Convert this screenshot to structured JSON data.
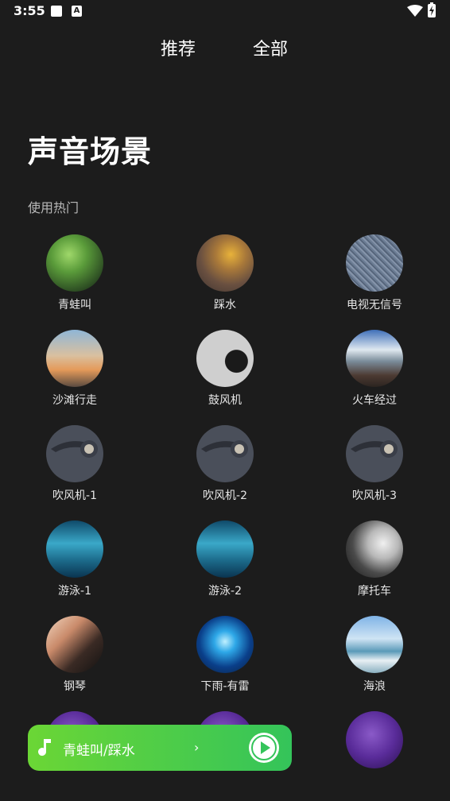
{
  "status_bar": {
    "time": "3:55",
    "icons": [
      "notification-square-icon",
      "accessibility-a-icon",
      "wifi-icon",
      "battery-charging-icon"
    ]
  },
  "tabs": [
    {
      "label": "推荐"
    },
    {
      "label": "全部"
    }
  ],
  "page": {
    "title": "声音场景",
    "section_label": "使用热门"
  },
  "scenes": [
    {
      "label": "青蛙叫",
      "image": "frog"
    },
    {
      "label": "踩水",
      "image": "splash"
    },
    {
      "label": "电视无信号",
      "image": "tv-static"
    },
    {
      "label": "沙滩行走",
      "image": "beach"
    },
    {
      "label": "鼓风机",
      "image": "blower"
    },
    {
      "label": "火车经过",
      "image": "train"
    },
    {
      "label": "吹风机-1",
      "image": "hair-dryer"
    },
    {
      "label": "吹风机-2",
      "image": "hair-dryer"
    },
    {
      "label": "吹风机-3",
      "image": "hair-dryer"
    },
    {
      "label": "游泳-1",
      "image": "swimming"
    },
    {
      "label": "游泳-2",
      "image": "swimming"
    },
    {
      "label": "摩托车",
      "image": "motorcycle"
    },
    {
      "label": "钢琴",
      "image": "piano"
    },
    {
      "label": "下雨-有雷",
      "image": "thunderstorm"
    },
    {
      "label": "海浪",
      "image": "ocean-wave"
    }
  ],
  "player": {
    "title": "青蛙叫/踩水",
    "chevron": "›",
    "icons": [
      "music-note-icon",
      "play-icon"
    ],
    "accent_start": "#6bd635",
    "accent_end": "#34c45a"
  },
  "colors": {
    "background": "#1c1c1c",
    "text": "#ffffff",
    "secondary_text": "#b8b8b8"
  }
}
